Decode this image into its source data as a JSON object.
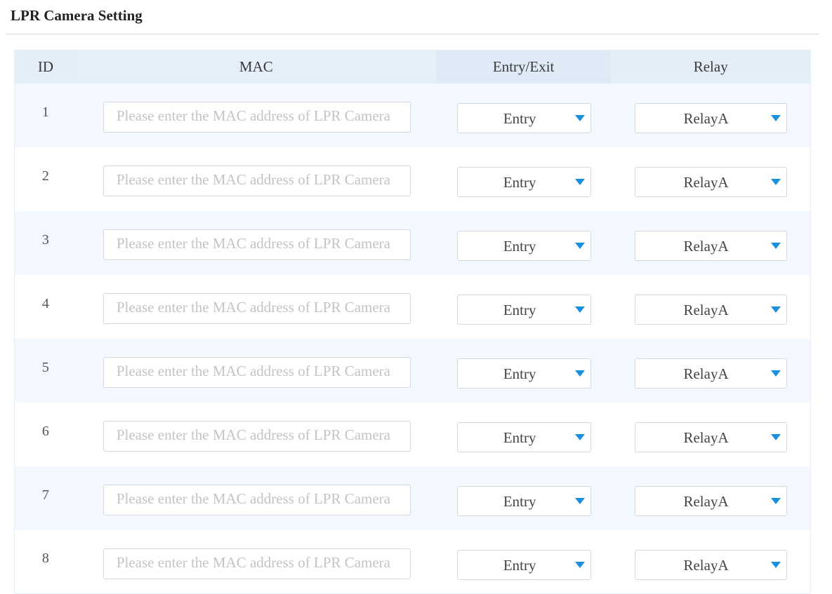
{
  "page": {
    "title": "LPR Camera Setting"
  },
  "table": {
    "headers": {
      "id": "ID",
      "mac": "MAC",
      "entry_exit": "Entry/Exit",
      "relay": "Relay"
    },
    "mac_placeholder": "Please enter the MAC address of LPR Camera",
    "rows": [
      {
        "id": "1",
        "mac": "",
        "entry_exit": "Entry",
        "relay": "RelayA"
      },
      {
        "id": "2",
        "mac": "",
        "entry_exit": "Entry",
        "relay": "RelayA"
      },
      {
        "id": "3",
        "mac": "",
        "entry_exit": "Entry",
        "relay": "RelayA"
      },
      {
        "id": "4",
        "mac": "",
        "entry_exit": "Entry",
        "relay": "RelayA"
      },
      {
        "id": "5",
        "mac": "",
        "entry_exit": "Entry",
        "relay": "RelayA"
      },
      {
        "id": "6",
        "mac": "",
        "entry_exit": "Entry",
        "relay": "RelayA"
      },
      {
        "id": "7",
        "mac": "",
        "entry_exit": "Entry",
        "relay": "RelayA"
      },
      {
        "id": "8",
        "mac": "",
        "entry_exit": "Entry",
        "relay": "RelayA"
      }
    ]
  },
  "icons": {
    "dropdown_caret": "caret-down-icon"
  },
  "colors": {
    "accent": "#1a8fdd",
    "header_bg": "#e0ecf7",
    "stripe_bg": "#f2f8fd"
  }
}
